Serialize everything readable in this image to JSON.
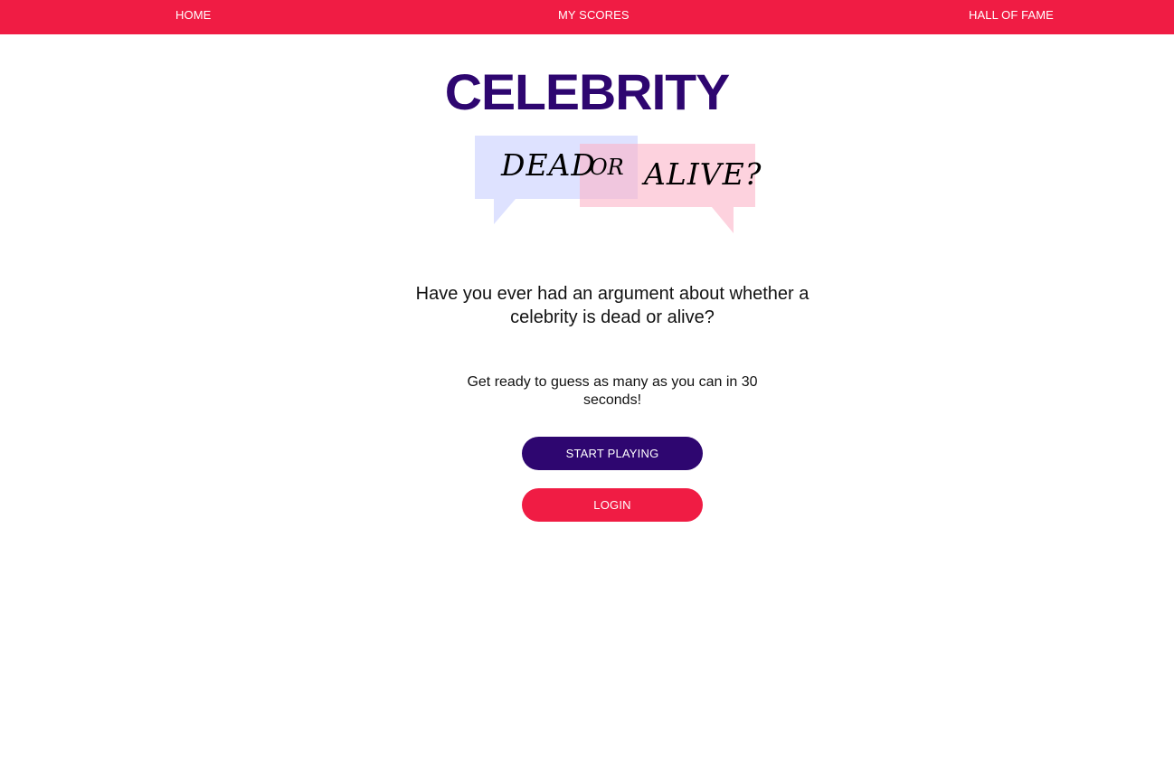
{
  "nav": {
    "home": "HOME",
    "my_scores": "MY SCORES",
    "hall_of_fame": "HALL OF FAME"
  },
  "logo": {
    "title": "CELEBRITY",
    "word_dead": "DEAD",
    "word_or": "OR",
    "word_alive": "ALIVE?"
  },
  "intro": {
    "question": "Have you ever had an argument about whether a celebrity is dead or alive?",
    "instructions": "Get ready to guess as many as you can in 30 seconds!"
  },
  "buttons": {
    "start_label": "START PLAYING",
    "login_label": "LOGIN"
  },
  "colors": {
    "brand_red": "#f01c44",
    "brand_purple": "#2e0670",
    "bubble_blue": "#c8ceff",
    "bubble_pink": "#fbb4c8"
  }
}
